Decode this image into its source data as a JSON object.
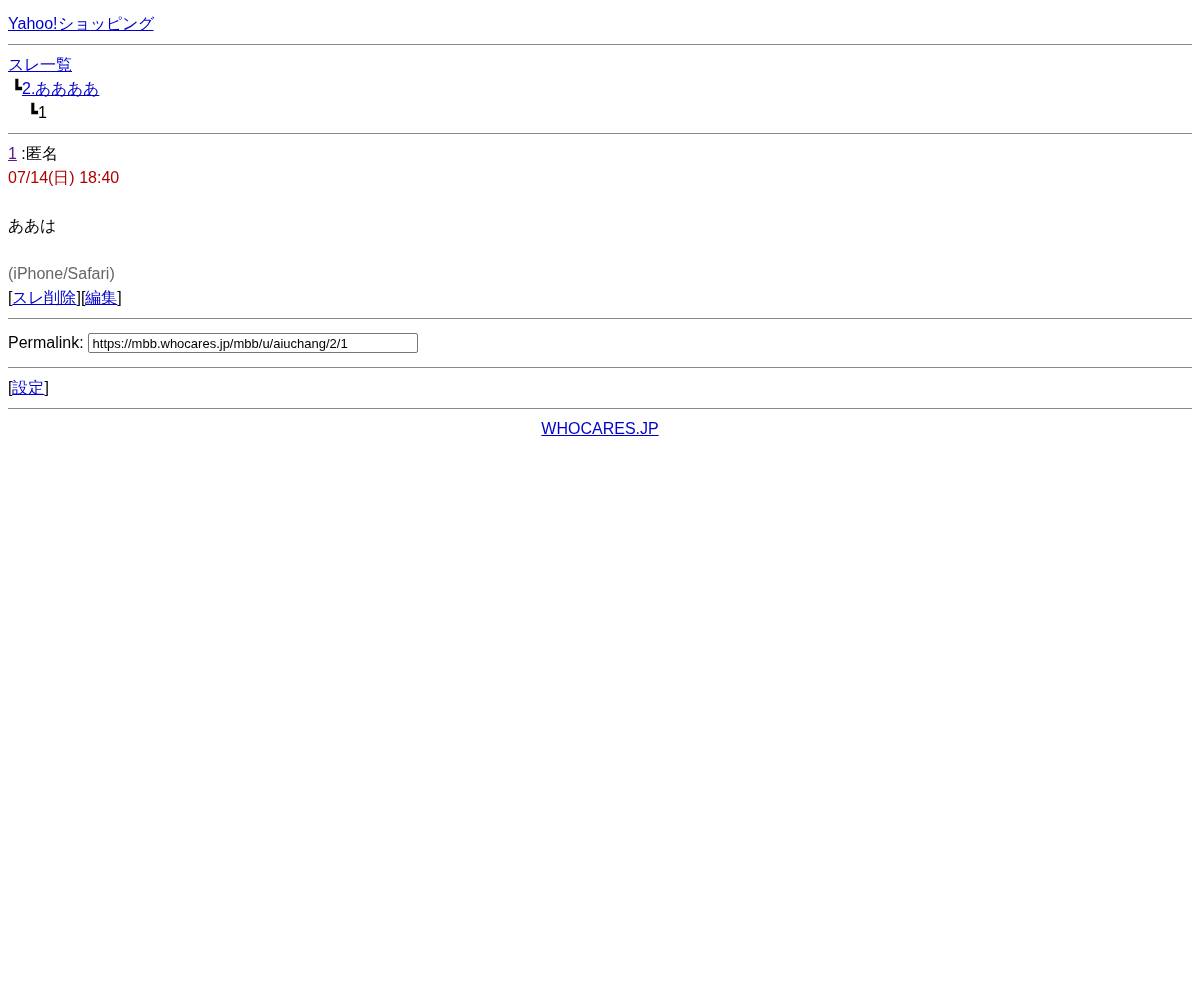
{
  "header_link": "Yahoo!ショッピング",
  "thread_nav": {
    "label": "スレ一覧",
    "children": [
      {
        "branch": "┗",
        "label": "2.ああああ",
        "kind": "link",
        "children": [
          {
            "branch": "┗",
            "label": "1",
            "kind": "text"
          }
        ]
      }
    ]
  },
  "post": {
    "number": "1",
    "separator": ":",
    "author": "匿名",
    "date": "07/14(日) 18:40",
    "body": "ああは",
    "device": "(iPhone/Safari)",
    "actions": [
      {
        "open": "[",
        "label": "スレ削除",
        "close": "]"
      },
      {
        "open": "[",
        "label": "編集",
        "close": "]"
      }
    ]
  },
  "permalink": {
    "label": "Permalink:",
    "value": "https://mbb.whocares.jp/mbb/u/aiuchang/2/1"
  },
  "settings": {
    "open": "[",
    "label": "設定",
    "close": "]"
  },
  "footer_link": "WHOCARES.JP"
}
